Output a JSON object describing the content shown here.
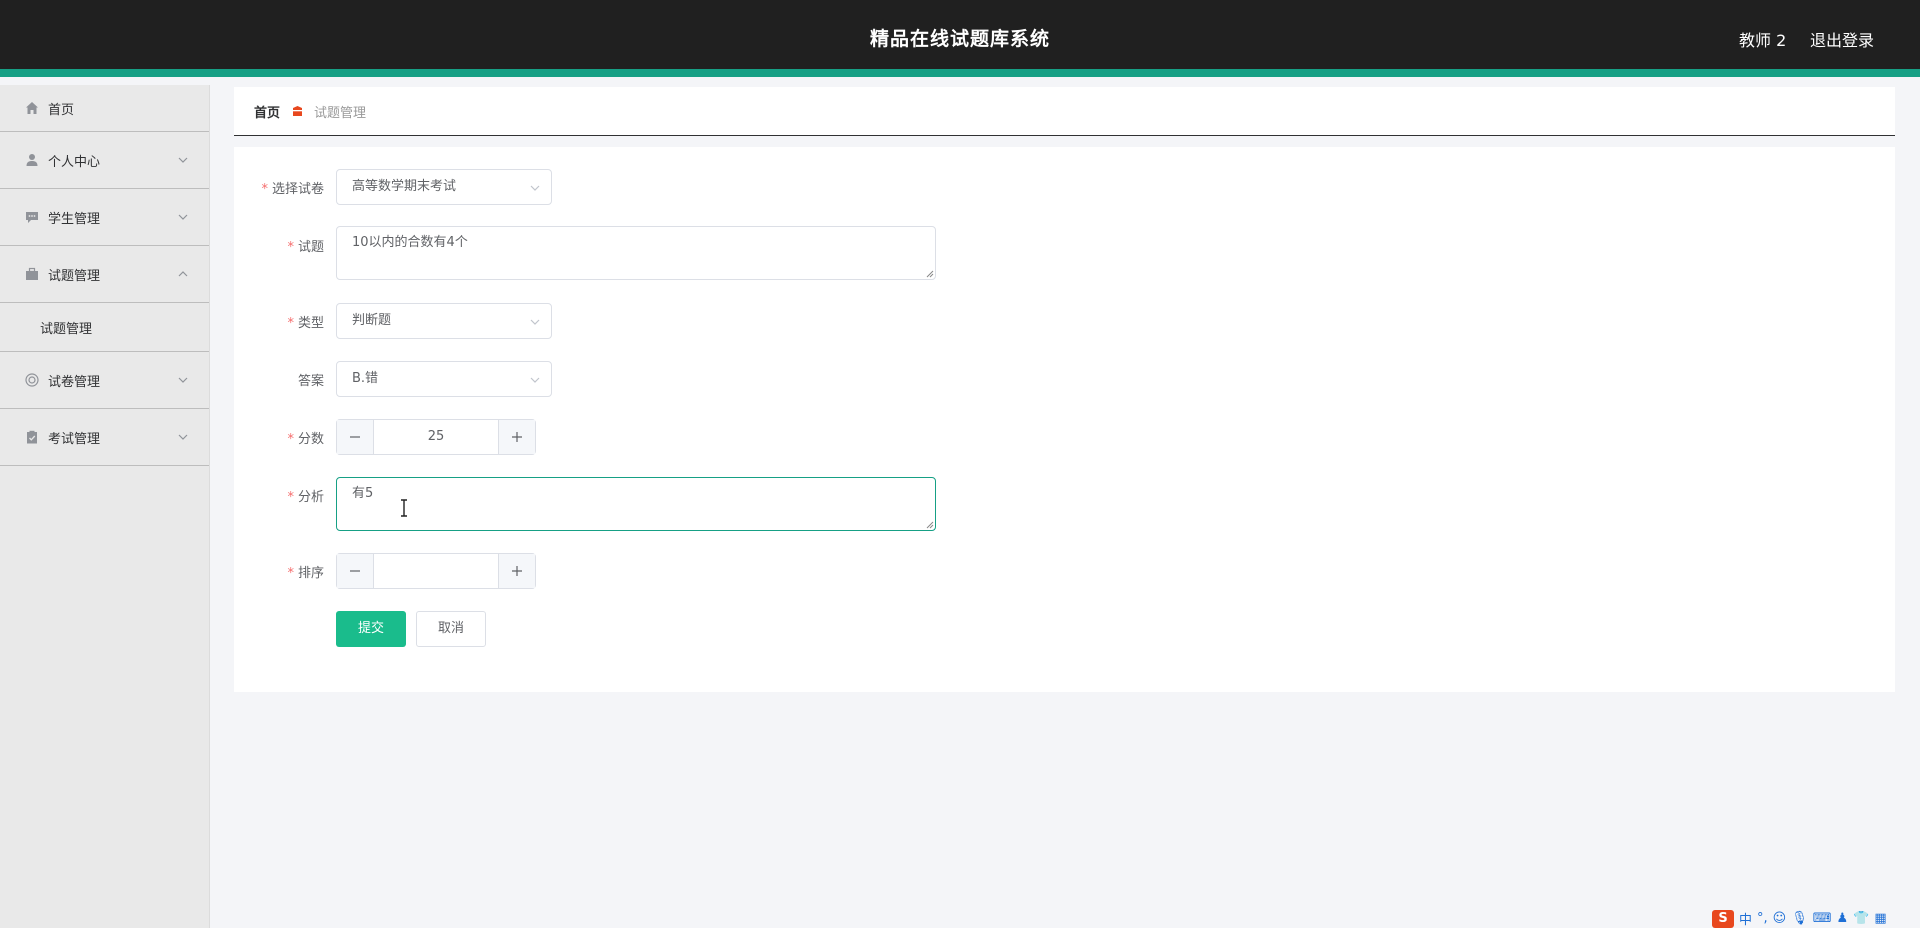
{
  "header": {
    "title": "精品在线试题库系统",
    "user": "教师 2",
    "logout": "退出登录"
  },
  "sidebar": {
    "items": [
      {
        "label": "首页",
        "icon": "home-icon"
      },
      {
        "label": "个人中心",
        "icon": "user-icon"
      },
      {
        "label": "学生管理",
        "icon": "chat-icon"
      },
      {
        "label": "试题管理",
        "icon": "briefcase-icon",
        "expanded": true,
        "sub": "试题管理"
      },
      {
        "label": "试卷管理",
        "icon": "circle-icon"
      },
      {
        "label": "考试管理",
        "icon": "clipboard-icon"
      }
    ]
  },
  "breadcrumb": {
    "home": "首页",
    "current": "试题管理"
  },
  "form": {
    "paper": {
      "label": "选择试卷",
      "value": "高等数学期末考试"
    },
    "question": {
      "label": "试题",
      "value": "10以内的合数有4个"
    },
    "type": {
      "label": "类型",
      "value": "判断题"
    },
    "answer": {
      "label": "答案",
      "value": "B.错"
    },
    "score": {
      "label": "分数",
      "value": "25"
    },
    "analysis": {
      "label": "分析",
      "value": "有5"
    },
    "order": {
      "label": "排序",
      "value": ""
    },
    "submit": "提交",
    "cancel": "取消"
  },
  "ime": {
    "logo": "S",
    "lang": "中"
  },
  "colors": {
    "accent": "#16a085",
    "primary_button": "#1abc8c",
    "required": "#f56c6c",
    "topbar": "#202020"
  }
}
